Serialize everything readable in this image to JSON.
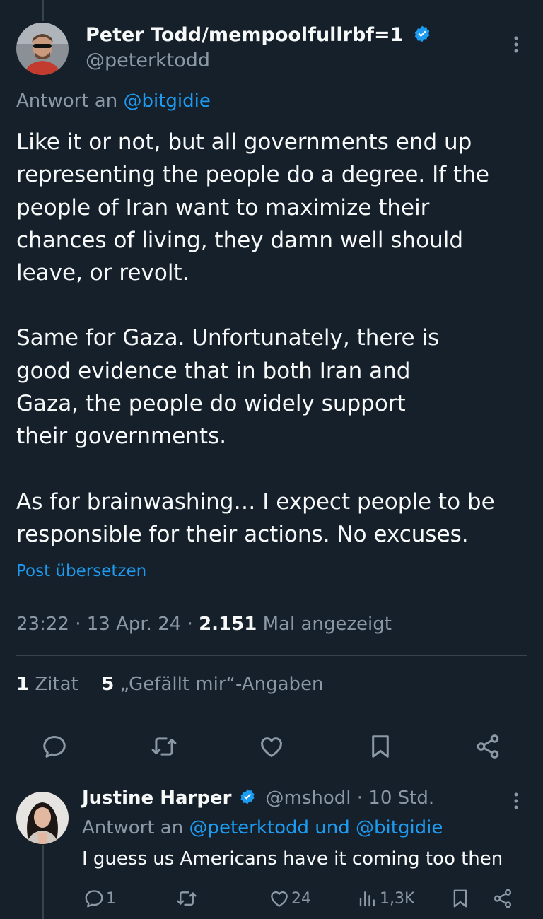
{
  "main_post": {
    "author_name": "Peter Todd/mempoolfullrbf=1",
    "author_handle": "@peterktodd",
    "reply_prefix": "Antwort an",
    "reply_target": "@bitgidie",
    "paragraphs": [
      "Like it or not, but all governments end up representing the people do a degree. If the people of Iran want to maximize their chances of living, they damn well should leave, or revolt.",
      "Same for Gaza. Unfortunately, there is good evidence that in both Iran and Gaza, the people do widely support their governments.",
      "As for brainwashing… I expect people to be responsible for their actions. No excuses."
    ],
    "translate_label": "Post übersetzen",
    "time": "23:22",
    "date": "13 Apr. 24",
    "views_count": "2.151",
    "views_label": "Mal angezeigt",
    "quotes_count": "1",
    "quotes_label": "Zitat",
    "likes_count": "5",
    "likes_label": "„Gefällt mir“-Angaben"
  },
  "reply_post": {
    "author_name": "Justine Harper",
    "author_handle": "@mshodl",
    "time_ago": "· 10 Std.",
    "reply_prefix": "Antwort an",
    "reply_target_1": "@peterktodd",
    "reply_and": "und",
    "reply_target_2": "@bitgidie",
    "text": "I guess us Americans have it coming too then",
    "replies_count": "1",
    "likes_count": "24",
    "views_count": "1,3K"
  },
  "colors": {
    "background": "#15202b",
    "text": "#f7f9f9",
    "secondary": "#8b98a5",
    "accent": "#1d9bf0",
    "divider": "#38444d"
  },
  "icons": [
    "verified-badge-icon",
    "more-icon",
    "reply-icon",
    "retweet-icon",
    "like-icon",
    "bookmark-icon",
    "share-icon",
    "views-icon"
  ]
}
